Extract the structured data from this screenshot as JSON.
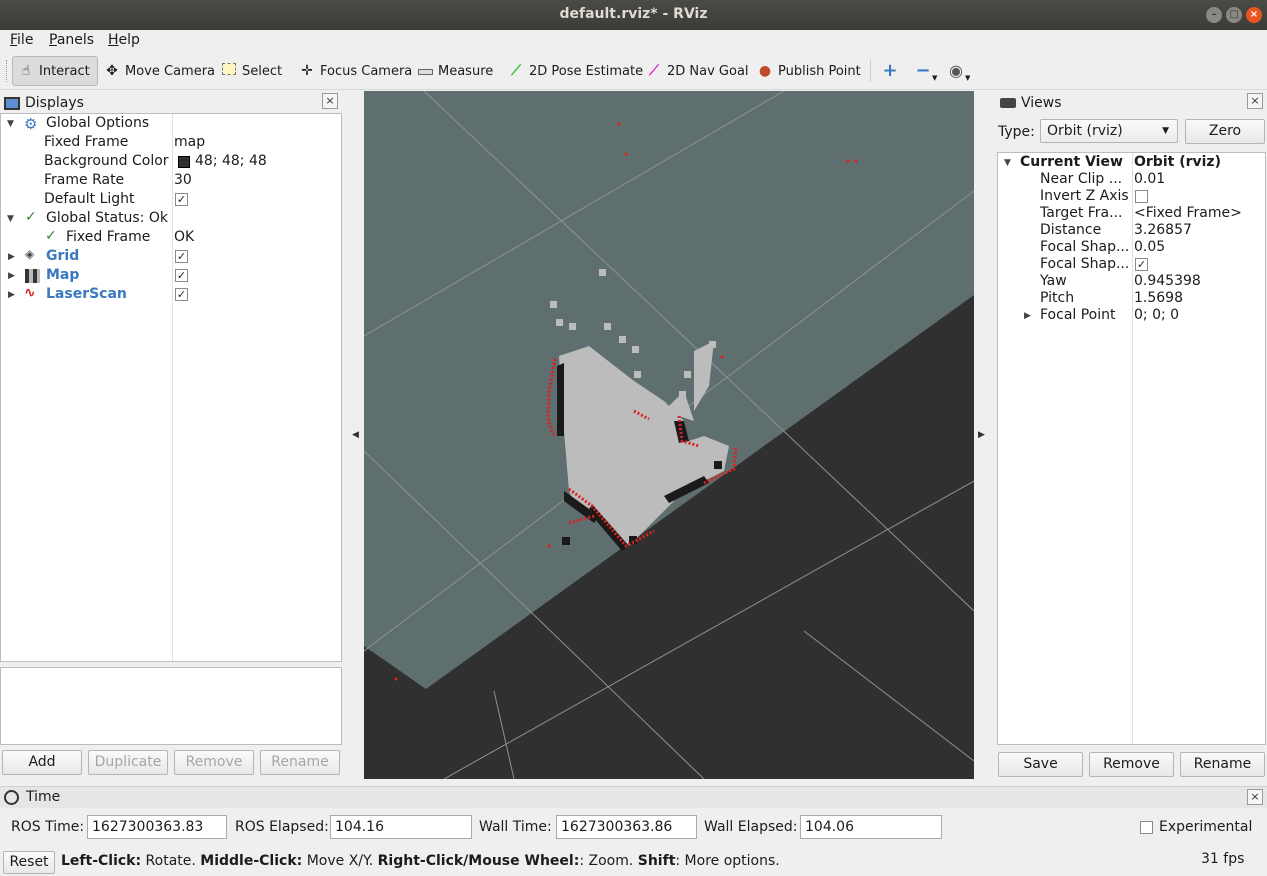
{
  "window": {
    "title": "default.rviz* - RViz"
  },
  "menu": {
    "file": "File",
    "file_u": "F",
    "file_rest": "ile",
    "panels_u": "P",
    "panels_rest": "anels",
    "help_u": "H",
    "help_rest": "elp"
  },
  "toolbar": {
    "interact": "Interact",
    "move_camera": "Move Camera",
    "select": "Select",
    "focus_camera": "Focus Camera",
    "measure": "Measure",
    "pose_estimate": "2D Pose Estimate",
    "nav_goal": "2D Nav Goal",
    "publish_point": "Publish Point"
  },
  "displays": {
    "title": "Displays",
    "global_options": "Global Options",
    "fixed_frame_label": "Fixed Frame",
    "fixed_frame_value": "map",
    "bg_color_label": "Background Color",
    "bg_color_value": "48; 48; 48",
    "bg_color_swatch": "#303030",
    "frame_rate_label": "Frame Rate",
    "frame_rate_value": "30",
    "default_light_label": "Default Light",
    "default_light_checked": true,
    "global_status": "Global Status: Ok",
    "status_fixed_frame_label": "Fixed Frame",
    "status_fixed_frame_value": "OK",
    "items": [
      {
        "name": "Grid",
        "checked": true
      },
      {
        "name": "Map",
        "checked": true
      },
      {
        "name": "LaserScan",
        "checked": true
      }
    ],
    "buttons": {
      "add": "Add",
      "duplicate": "Duplicate",
      "remove": "Remove",
      "rename": "Rename"
    }
  },
  "views": {
    "title": "Views",
    "type_label": "Type:",
    "type_value": "Orbit (rviz)",
    "zero": "Zero",
    "current_view_label": "Current View",
    "current_view_value": "Orbit (rviz)",
    "props": [
      {
        "label": "Near Clip ...",
        "value": "0.01"
      },
      {
        "label": "Invert Z Axis",
        "value": ""
      },
      {
        "label": "Target Fra...",
        "value": "<Fixed Frame>"
      },
      {
        "label": "Distance",
        "value": "3.26857"
      },
      {
        "label": "Focal Shap...",
        "value": "0.05"
      },
      {
        "label": "Focal Shap...",
        "value": ""
      },
      {
        "label": "Yaw",
        "value": "0.945398"
      },
      {
        "label": "Pitch",
        "value": "1.5698"
      },
      {
        "label": "Focal Point",
        "value": "0; 0; 0"
      }
    ],
    "buttons": {
      "save": "Save",
      "remove": "Remove",
      "rename": "Rename"
    }
  },
  "time": {
    "title": "Time",
    "ros_time_label": "ROS Time:",
    "ros_time": "1627300363.83",
    "ros_elapsed_label": "ROS Elapsed:",
    "ros_elapsed": "104.16",
    "wall_time_label": "Wall Time:",
    "wall_time": "1627300363.86",
    "wall_elapsed_label": "Wall Elapsed:",
    "wall_elapsed": "104.06",
    "experimental": "Experimental"
  },
  "status": {
    "reset": "Reset",
    "left_click": "Left-Click:",
    "left_click_action": " Rotate. ",
    "middle_click": "Middle-Click:",
    "middle_click_action": " Move X/Y. ",
    "right_click": "Right-Click/Mouse Wheel:",
    "right_click_action": ": Zoom. ",
    "shift": "Shift",
    "shift_action": ": More options.",
    "fps": "31 fps"
  },
  "colors": {
    "accent": "#e95420",
    "map_known": "#5f6e6e",
    "scan": "#e02020"
  }
}
